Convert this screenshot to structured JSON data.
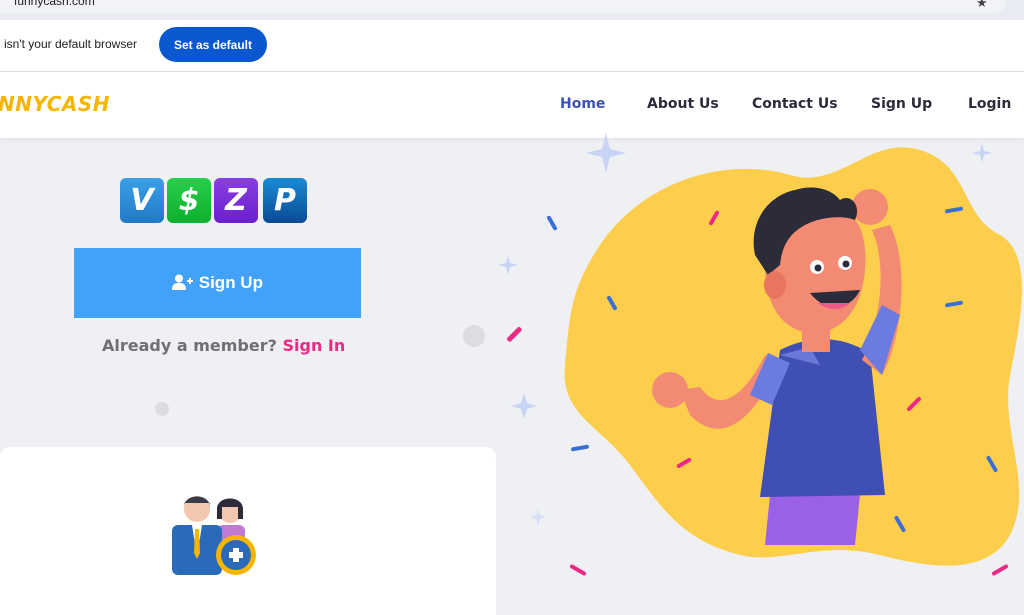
{
  "browser": {
    "address_text": "funnycash.com",
    "infobar_message": "isn't your default browser",
    "infobar_button": "Set as default"
  },
  "header": {
    "logo_text": "NNYCASH",
    "nav": [
      {
        "label": "Home"
      },
      {
        "label": "About Us"
      },
      {
        "label": "Contact Us"
      },
      {
        "label": "Sign Up"
      },
      {
        "label": "Login"
      }
    ]
  },
  "hero": {
    "payment_icons": [
      "venmo-icon",
      "cashapp-icon",
      "zelle-icon",
      "paypal-icon"
    ],
    "payment_glyphs": [
      "V",
      "$",
      "Z",
      "P"
    ],
    "signup_label": "Sign Up",
    "member_prompt": "Already a member?",
    "signin_label": "Sign In"
  },
  "colors": {
    "nav_active": "#3c50b8",
    "signup_button": "#42a1f8",
    "signin_link": "#ec2a86",
    "logo": "#f7b500",
    "browser_button": "#0b57d0"
  }
}
